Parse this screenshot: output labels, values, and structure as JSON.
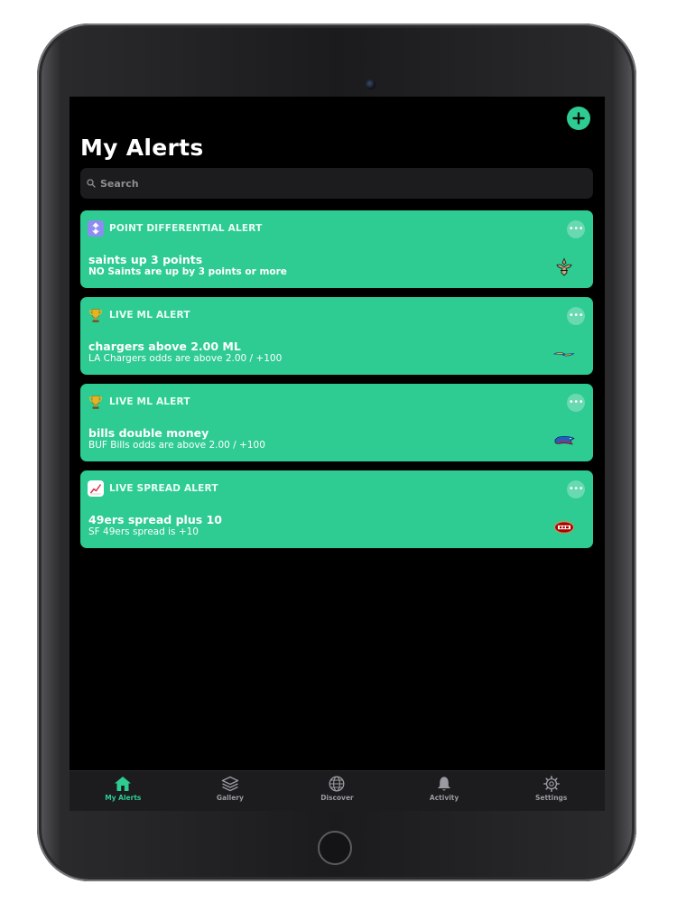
{
  "header": {
    "title": "My Alerts"
  },
  "search": {
    "placeholder": "Search"
  },
  "alerts": [
    {
      "type_label": "POINT DIFFERENTIAL ALERT",
      "type_icon": "up-down-arrows-icon",
      "title": "saints up 3 points",
      "subtitle": "NO Saints are up by 3 points or more",
      "team_logo": "saints-logo"
    },
    {
      "type_label": "LIVE ML ALERT",
      "type_icon": "trophy-icon",
      "title": "chargers above 2.00 ML",
      "subtitle": "LA Chargers odds are above 2.00 / +100",
      "team_logo": "chargers-logo"
    },
    {
      "type_label": "LIVE ML ALERT",
      "type_icon": "trophy-icon",
      "title": "bills double money",
      "subtitle": "BUF Bills odds are above 2.00 / +100",
      "team_logo": "bills-logo"
    },
    {
      "type_label": "LIVE SPREAD ALERT",
      "type_icon": "chart-up-icon",
      "title": "49ers spread plus 10",
      "subtitle": "SF 49ers spread is +10",
      "team_logo": "49ers-logo"
    }
  ],
  "tabs": [
    {
      "label": "My Alerts",
      "icon": "home-icon",
      "active": true
    },
    {
      "label": "Gallery",
      "icon": "layers-icon",
      "active": false
    },
    {
      "label": "Discover",
      "icon": "globe-icon",
      "active": false
    },
    {
      "label": "Activity",
      "icon": "bell-icon",
      "active": false
    },
    {
      "label": "Settings",
      "icon": "gear-icon",
      "active": false
    }
  ],
  "colors": {
    "accent": "#2ecb93",
    "background": "#000000",
    "search_bg": "#1c1c1e",
    "tabbar_bg": "#1c1c1e"
  }
}
